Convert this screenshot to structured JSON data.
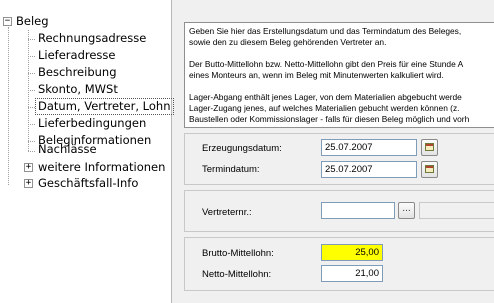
{
  "tree": {
    "root": {
      "label": "Beleg",
      "expander": "−"
    },
    "items": [
      {
        "label": "Rechnungsadresse"
      },
      {
        "label": "Lieferadresse"
      },
      {
        "label": "Beschreibung"
      },
      {
        "label": "Skonto, MWSt"
      },
      {
        "label": "Datum, Vertreter, Lohn",
        "selected": true
      },
      {
        "label": "Lieferbedingungen"
      },
      {
        "label": "Beleginformationen"
      },
      {
        "label": "Nachlässe"
      }
    ],
    "collapsed": [
      {
        "label": "weitere Informationen",
        "expander": "+"
      },
      {
        "label": "Geschäftsfall-Info",
        "expander": "+"
      }
    ]
  },
  "info": {
    "paragraph1": [
      "Geben Sie hier das Erstellungsdatum und das Termindatum des Beleges,",
      "sowie den zu diesem Beleg gehörenden Vertreter an."
    ],
    "paragraph2": [
      "Der Butto-Mittellohn bzw. Netto-Mittellohn gibt den Preis für eine Stunde A",
      "eines Monteurs an, wenn im Beleg mit Minutenwerten kalkuliert wird."
    ],
    "paragraph3": [
      "Lager-Abgang enthält jenes Lager, von dem Materialien abgebucht werde",
      "Lager-Zugang jenes, auf welches Materialien gebucht werden können (z.",
      "Baustellen oder Kommissionslager - falls für diesen Beleg möglich und vorh"
    ]
  },
  "dates": {
    "erzeugungsdatum_label": "Erzeugungsdatum:",
    "erzeugungsdatum_value": "25.07.2007",
    "termindatum_label": "Termindatum:",
    "termindatum_value": "25.07.2007",
    "calendar_icon": "calendar-icon"
  },
  "vertreter": {
    "label": "Vertreternr.:",
    "value": "",
    "browse_label": "..."
  },
  "lohn": {
    "brutto_label": "Brutto-Mittellohn:",
    "brutto_value": "25,00",
    "netto_label": "Netto-Mittellohn:",
    "netto_value": "21,00",
    "highlight_color": "#ffff00"
  }
}
